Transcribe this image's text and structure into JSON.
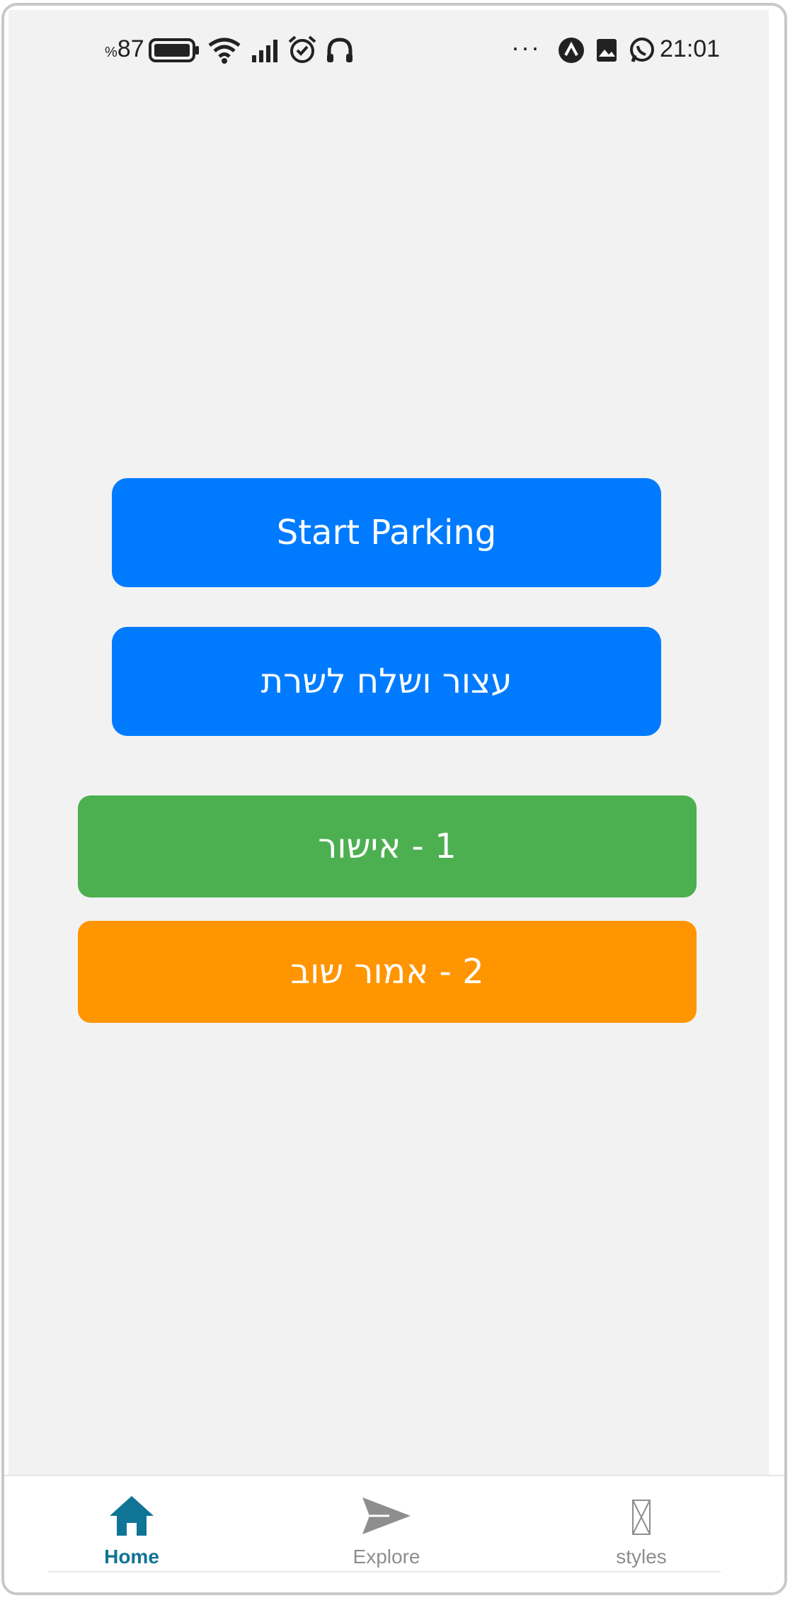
{
  "status_bar": {
    "battery_percent_symbol": "%",
    "battery_value": "87",
    "time": "21:01",
    "dots": "···",
    "icons": [
      "battery-icon",
      "wifi-icon",
      "signal-icon",
      "alarm-icon",
      "headphones-icon",
      "more-dots-icon",
      "app-a-icon",
      "gallery-icon",
      "whatsapp-icon"
    ]
  },
  "buttons": {
    "start_parking": "Start Parking",
    "stop_and_send": "עצור ושלח לשרת",
    "confirm": "1 - אישור",
    "say_again": "2 - אמור שוב"
  },
  "colors": {
    "primary_blue": "#007bff",
    "confirm_green": "#4caf50",
    "repeat_orange": "#ff9500",
    "tab_active": "#0f7496",
    "tab_inactive": "#8e8e8e"
  },
  "tabs": [
    {
      "label": "Home",
      "icon": "home-icon",
      "active": true
    },
    {
      "label": "Explore",
      "icon": "send-icon",
      "active": false
    },
    {
      "label": "styles",
      "icon": "missing-image-icon",
      "active": false
    }
  ]
}
